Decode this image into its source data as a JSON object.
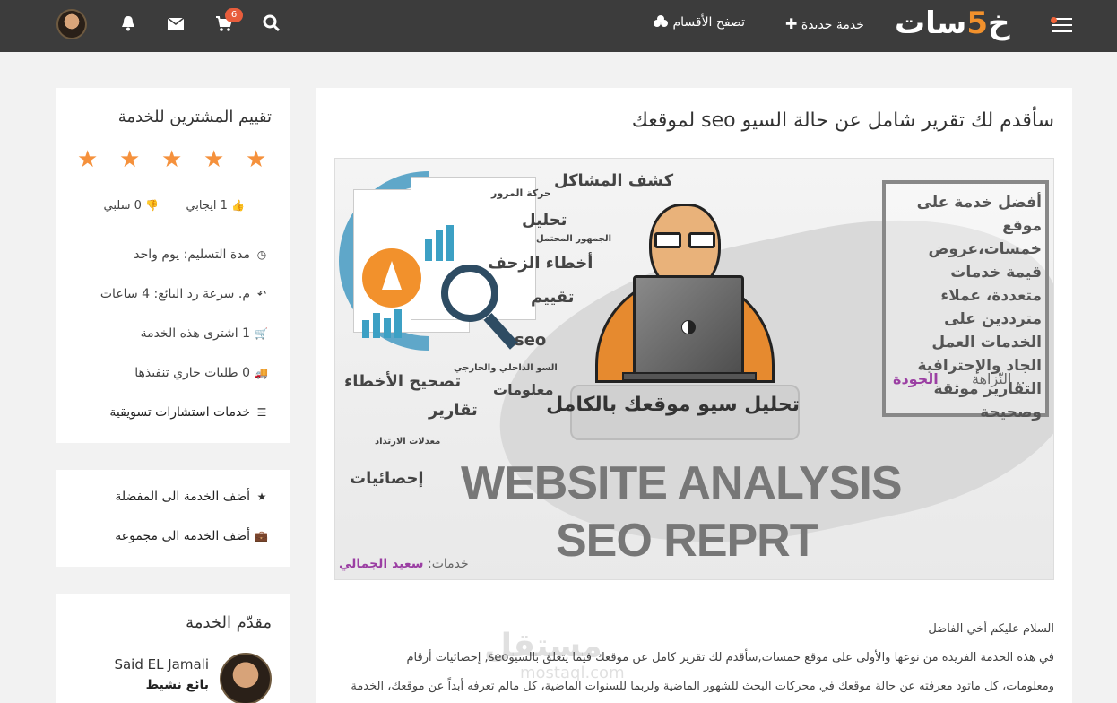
{
  "topbar": {
    "logo_text": "خمسات",
    "logo_five": "5",
    "new_service": "خدمة جديدة",
    "browse_categories": "تصفح الأقسام",
    "cart_count": "6",
    "icons": [
      "menu-icon",
      "plus-icon",
      "gamepad-icon",
      "search-icon",
      "cart-icon",
      "mail-icon",
      "bell-icon",
      "avatar"
    ]
  },
  "service": {
    "title": "سأقدم لك تقرير شامل عن حالة السيو seo لموقعك",
    "body_lines": [
      "السلام عليكم أخي الفاضل",
      "في هذه الخدمة الفريدة من نوعها والأولى على موقع خمسات,سأقدم لك تقرير كامل عن موقعك فيما يتعلق بالسيوseo, إحصائيات أرقام",
      "ومعلومات، كل ماتود معرفته عن حالة موقعك في محركات البحث للشهور الماضية ولربما للسنوات الماضية، كل مالم تعرفه أبداً عن موقعك، الخدمة"
    ]
  },
  "hero_image": {
    "labels": {
      "detect_problems": "كشف المشاكل",
      "traffic": "حركة المرور",
      "analysis": "تحليل",
      "potential_audience": "الجمهور المحتمل",
      "crawl_errors": "أخطاء الزحف",
      "evaluation": "تقييم",
      "seo": "seo",
      "internal_external_seo": "السو الداخلي والخارجي",
      "information": "معلومات",
      "fix_errors": "تصحيح الأخطاء",
      "reports": "تقارير",
      "bounce_rates": "معدلات الارتداد",
      "statistics": "إحصائيات"
    },
    "banner": "تحليل سيو موقعك بالكامل",
    "box_text": "أفضل خدمة على موقع خمسات،عروض قيمة خدمات متعددة، عملاء مترددين على الخدمات العمل الجاد والإحترافية التقارير موثقة وصحيحة",
    "box_tag_honesty": "النّزاهة ..",
    "box_tag_quality": "الجودة",
    "line1": "WEBSITE ANALYSIS",
    "line2": "SEO REPRT",
    "credit_prefix": "خدمات:",
    "credit_name": "سعيد الجمالي"
  },
  "rating_card": {
    "title": "تقييم المشترين للخدمة",
    "stars": 5,
    "positive": "1 ايجابي",
    "negative": "0 سلبي",
    "delivery": "مدة التسليم: يوم واحد",
    "response": "م. سرعة رد البائع: 4 ساعات",
    "purchases": "1 اشترى هذه الخدمة",
    "in_progress": "0 طلبات جاري تنفيذها",
    "category": "خدمات استشارات تسويقية"
  },
  "actions_card": {
    "add_favorite": "أضف الخدمة الى المفضلة",
    "add_collection": "أضف الخدمة الى مجموعة"
  },
  "seller_card": {
    "title": "مقدّم الخدمة",
    "name": "Said EL Jamali",
    "level": "بائع نشيط"
  },
  "watermark": {
    "main": "مستقل",
    "sub": "mostaql.com"
  },
  "colors": {
    "topbar": "#3c3c3c",
    "accent_orange": "#f5913c",
    "badge": "#e85d3c",
    "purple_credit": "#9b3fa3"
  }
}
